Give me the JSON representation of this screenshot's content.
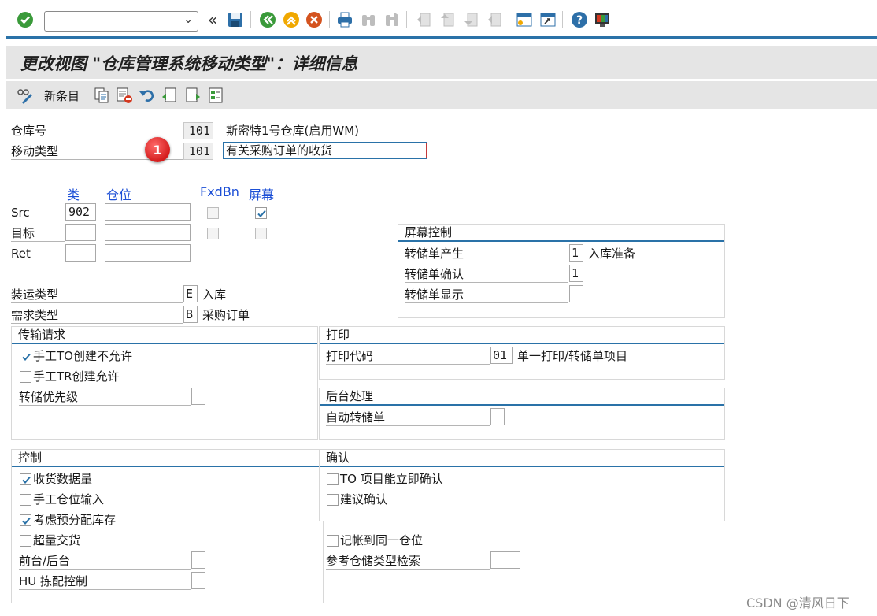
{
  "command_field": {
    "value": "",
    "placeholder": ""
  },
  "system_toolbar": {
    "icons": [
      "enter-icon",
      "back-icon",
      "save-icon",
      "exit-icon",
      "cancel-icon",
      "print-icon",
      "find-icon",
      "find-next-icon",
      "first-page-icon",
      "previous-page-icon",
      "next-page-icon",
      "last-page-icon",
      "new-session-icon",
      "shortcut-icon",
      "help-icon",
      "customize-layout-icon"
    ]
  },
  "title": "更改视图 \"仓库管理系统移动类型\"：详细信息",
  "app_toolbar": {
    "new_entries": "新条目"
  },
  "header": {
    "warehouse_label": "仓库号",
    "warehouse_value": "101",
    "warehouse_desc": "斯密特1号仓库(启用WM)",
    "movement_label": "移动类型",
    "movement_value": "101",
    "movement_desc": "有关采购订单的收货",
    "marker": "1"
  },
  "bins": {
    "col_type": "类",
    "col_bin": "仓位",
    "col_fixed": "FxdBn",
    "col_screen": "屏幕",
    "rows": [
      {
        "label": "Src",
        "type": "902",
        "bin": "",
        "fixed": false,
        "screen": true
      },
      {
        "label": "目标",
        "type": "",
        "bin": "",
        "fixed": false,
        "screen": false
      },
      {
        "label": "Ret",
        "type": "",
        "bin": "",
        "fixed": false,
        "screen": false
      }
    ]
  },
  "shipping": {
    "label": "装运类型",
    "value": "E",
    "desc": "入库"
  },
  "requirement": {
    "label": "需求类型",
    "value": "B",
    "desc": "采购订单"
  },
  "screen_control": {
    "title": "屏幕控制",
    "rows": [
      {
        "label": "转储单产生",
        "value": "1",
        "desc": "入库准备"
      },
      {
        "label": "转储单确认",
        "value": "1",
        "desc": ""
      },
      {
        "label": "转储单显示",
        "value": "",
        "desc": ""
      }
    ]
  },
  "transfer_request": {
    "title": "传输请求",
    "manual_to_not_allowed": {
      "label": "手工TO创建不允许",
      "checked": true
    },
    "manual_tr_allowed": {
      "label": "手工TR创建允许",
      "checked": false
    },
    "priority": {
      "label": "转储优先级",
      "value": ""
    }
  },
  "print": {
    "title": "打印",
    "code_label": "打印代码",
    "code_value": "01",
    "code_desc": "单一打印/转储单项目"
  },
  "background": {
    "title": "后台处理",
    "auto_label": "自动转储单",
    "auto_value": ""
  },
  "control": {
    "title": "控制",
    "gr_data_qty": {
      "label": "收货数据量",
      "checked": true
    },
    "manual_bin_entry": {
      "label": "手工仓位输入",
      "checked": false
    },
    "consider_pre_alloc": {
      "label": "考虑预分配库存",
      "checked": true
    },
    "over_delivery": {
      "label": "超量交货",
      "checked": false
    },
    "fore_background": {
      "label": "前台/后台",
      "value": ""
    },
    "hu_picking": {
      "label": "HU 拣配控制",
      "value": ""
    }
  },
  "confirmation": {
    "title": "确认",
    "to_item_immediate": {
      "label": "TO 项目能立即确认",
      "checked": false
    },
    "propose_confirm": {
      "label": "建议确认",
      "checked": false
    }
  },
  "posting_same_bin": {
    "label": "记帐到同一仓位",
    "checked": false
  },
  "ref_storage_type_search": {
    "label": "参考仓储类型检索",
    "value": ""
  },
  "watermark": "CSDN @清风日下",
  "colors": {
    "accent_line": "#2a72a8",
    "title_bg": "#e5e5e5",
    "column_header": "#1c4fd6",
    "marker": "#d41c1c"
  }
}
